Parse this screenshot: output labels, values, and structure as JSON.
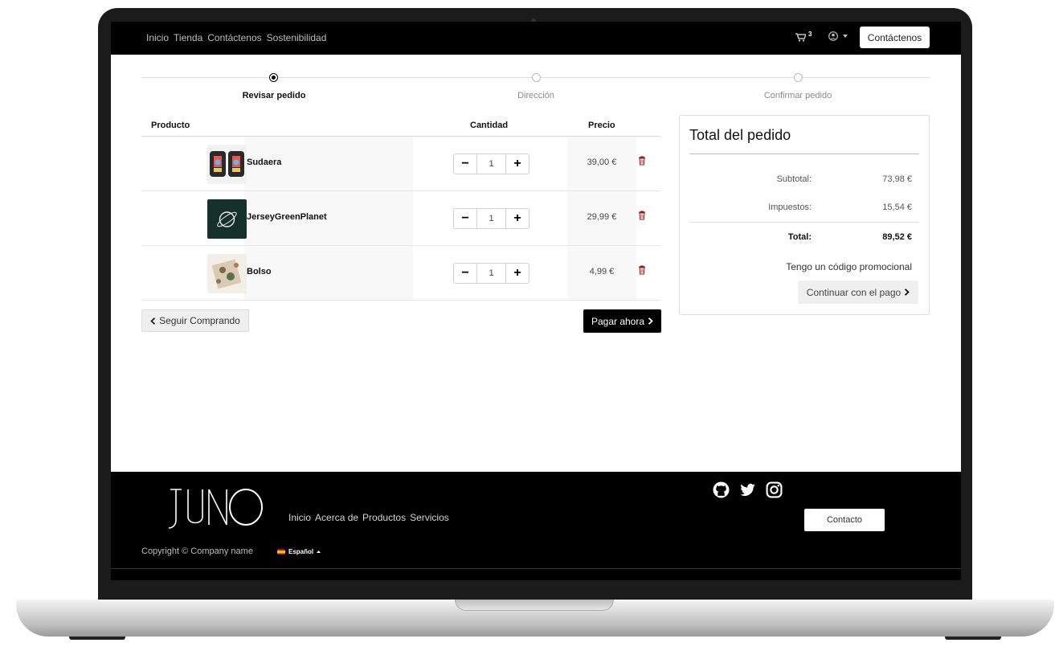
{
  "navbar": {
    "links": [
      "Inicio",
      "Tienda",
      "Contáctenos",
      "Sostenibilidad"
    ],
    "cart_count": "3",
    "contact_button": "Contáctenos",
    "cart_icon": "cart-icon",
    "user_icon": "user-circle-icon"
  },
  "steps": [
    {
      "label": "Revisar pedido",
      "active": true
    },
    {
      "label": "Dirección",
      "active": false
    },
    {
      "label": "Confirmar pedido",
      "active": false
    }
  ],
  "table": {
    "headers": {
      "product": "Producto",
      "quantity": "Cantidad",
      "price": "Precio"
    },
    "rows": [
      {
        "name": "Sudaera",
        "qty": "1",
        "price": "39,00 €"
      },
      {
        "name": "JerseyGreenPlanet",
        "qty": "1",
        "price": "29,99 €"
      },
      {
        "name": "Bolso",
        "qty": "1",
        "price": "4,99 €"
      }
    ]
  },
  "buttons": {
    "keep_shopping": "Seguir Comprando",
    "pay_now": "Pagar ahora"
  },
  "summary": {
    "title": "Total del pedido",
    "subtotal_label": "Subtotal:",
    "subtotal_value": "73,98 €",
    "tax_label": "Impuestos:",
    "tax_value": "15,54 €",
    "total_label": "Total:",
    "total_value": "89,52 €",
    "promo": "Tengo un código promocional",
    "continue": "Continuar con el pago"
  },
  "footer": {
    "links": [
      "Inicio",
      "Acerca de",
      "Productos",
      "Servicios"
    ],
    "copyright": "Copyright © Company name",
    "language": "Español",
    "contact_button": "Contacto"
  },
  "colors": {
    "navbar_bg": "#000000",
    "footer_bg": "#000000",
    "accent": "#000000"
  }
}
